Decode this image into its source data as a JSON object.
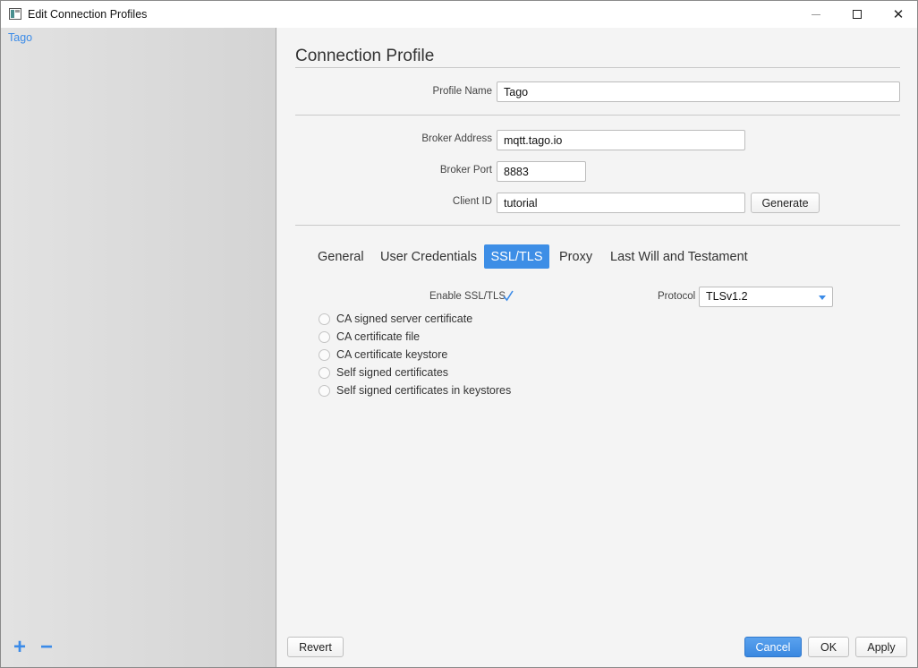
{
  "window": {
    "title": "Edit Connection Profiles",
    "controls": {
      "minimize": "minimize-icon",
      "maximize": "maximize-icon",
      "close": "✕"
    }
  },
  "sidebar": {
    "profiles": [
      {
        "label": "Tago",
        "selected": true
      }
    ],
    "add_label": "+",
    "remove_label": "−"
  },
  "profile": {
    "section_title": "Connection Profile",
    "name_label": "Profile Name",
    "name_value": "Tago",
    "broker_address_label": "Broker Address",
    "broker_address_value": "mqtt.tago.io",
    "broker_port_label": "Broker Port",
    "broker_port_value": "8883",
    "client_id_label": "Client ID",
    "client_id_value": "tutorial",
    "generate_label": "Generate"
  },
  "tabs": [
    {
      "label": "General",
      "active": false
    },
    {
      "label": "User Credentials",
      "active": false
    },
    {
      "label": "SSL/TLS",
      "active": true
    },
    {
      "label": "Proxy",
      "active": false
    },
    {
      "label": "Last Will and Testament",
      "active": false
    }
  ],
  "ssl": {
    "enable_label": "Enable SSL/TLS",
    "enable_checked": true,
    "protocol_label": "Protocol",
    "protocol_value": "TLSv1.2",
    "options": [
      {
        "label": "CA signed server certificate",
        "selected": false
      },
      {
        "label": "CA certificate file",
        "selected": false
      },
      {
        "label": "CA certificate keystore",
        "selected": false
      },
      {
        "label": "Self signed certificates",
        "selected": false
      },
      {
        "label": "Self signed certificates in keystores",
        "selected": false
      }
    ]
  },
  "footer": {
    "revert_label": "Revert",
    "cancel_label": "Cancel",
    "ok_label": "OK",
    "apply_label": "Apply"
  },
  "colors": {
    "accent": "#3d8ee6",
    "sidebar_bg": "#d9d9d9",
    "panel_bg": "#f4f4f4"
  }
}
